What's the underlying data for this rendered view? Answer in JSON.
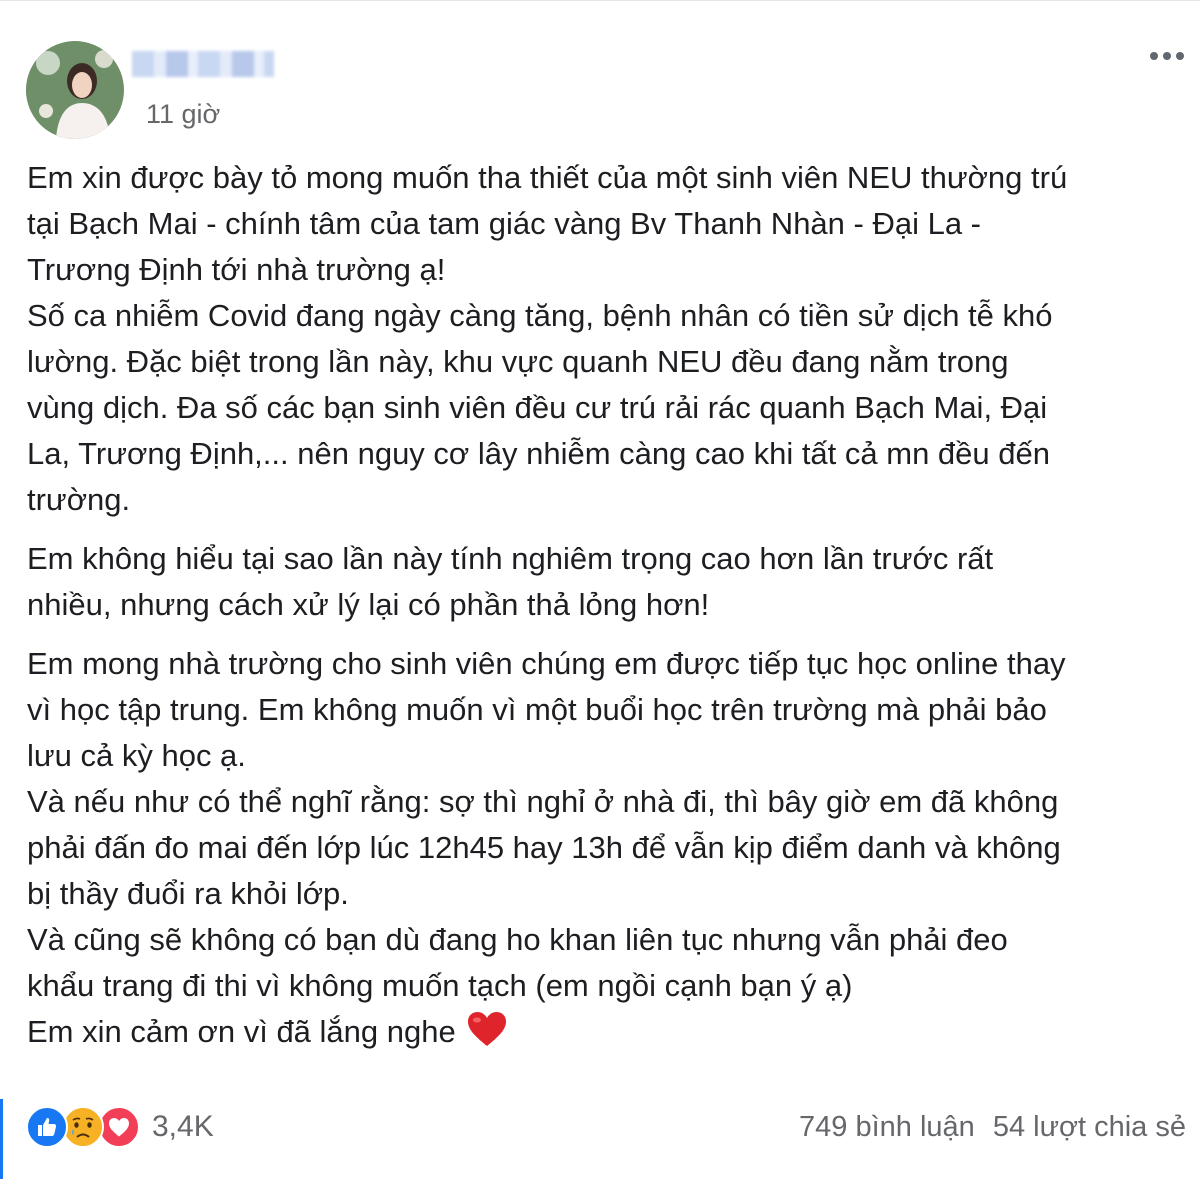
{
  "post": {
    "author_name": "",
    "timestamp": "11 giờ",
    "paragraphs": [
      "Em xin được bày tỏ mong muốn tha thiết của một sinh viên NEU thường trú\ntại Bạch Mai - chính tâm của tam giác vàng Bv Thanh Nhàn - Đại La -\nTrương Định tới nhà trường ạ!\nSố ca nhiễm Covid đang ngày càng tăng, bệnh nhân có tiền sử dịch tễ khó\nlường. Đặc biệt trong lần này, khu vực quanh NEU đều đang nằm trong\nvùng dịch. Đa số các bạn sinh viên đều cư trú rải rác quanh Bạch Mai, Đại\nLa, Trương Định,... nên nguy cơ lây nhiễm càng cao khi tất cả mn đều đến\ntrường.",
      "Em không hiểu tại sao lần này tính nghiêm trọng cao hơn lần trước rất\nnhiều, nhưng cách xử lý lại có phần thả lỏng hơn!",
      "Em mong nhà trường cho sinh viên chúng em được tiếp tục học online thay\nvì học tập trung. Em không muốn vì một buổi học trên trường mà phải bảo\nlưu cả kỳ học ạ.\nVà nếu như có thể nghĩ rằng: sợ thì nghỉ ở nhà đi, thì bây giờ em đã không\nphải đấn đo mai đến lớp lúc 12h45 hay 13h để vẫn kịp điểm danh và không\nbị thầy đuổi ra khỏi lớp.\nVà cũng sẽ không có bạn dù đang ho khan liên tục nhưng vẫn phải đeo\nkhẩu trang đi thi vì không muốn tạch (em ngồi cạnh bạn ý ạ)\nEm xin cảm ơn vì đã lắng nghe"
    ],
    "closing_icon": "red-heart-icon"
  },
  "reactions": {
    "icons": [
      "like-icon",
      "sad-icon",
      "love-icon"
    ],
    "count": "3,4K"
  },
  "stats": {
    "comments": "749 bình luận",
    "shares": "54 lượt chia sẻ"
  },
  "colors": {
    "text": "#1c1e21",
    "secondary_text": "#65676b",
    "like_blue": "#1877f2",
    "sad_yellow": "#f7b125",
    "love_red": "#f33e58",
    "heart_red": "#e0242b"
  }
}
